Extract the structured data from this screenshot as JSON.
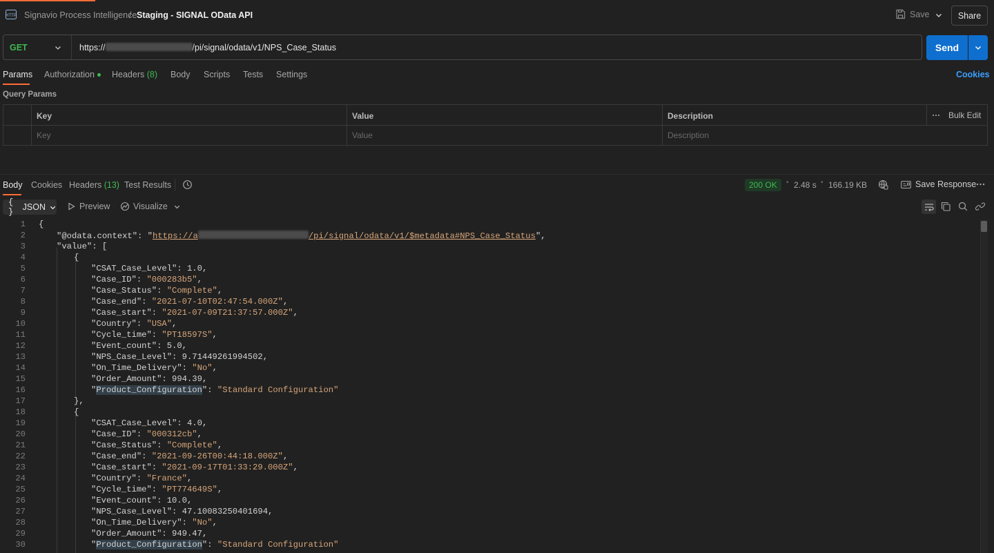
{
  "breadcrumb": {
    "workspace": "Signavio Process Intelligence",
    "separator": "/",
    "request_name": "Staging - SIGNAL OData API"
  },
  "header": {
    "save_label": "Save",
    "share_label": "Share"
  },
  "request": {
    "method": "GET",
    "url_prefix": "https://",
    "url_suffix": "/pi/signal/odata/v1/NPS_Case_Status",
    "send_label": "Send"
  },
  "request_tabs": {
    "params": "Params",
    "authorization": "Authorization",
    "headers": "Headers",
    "headers_count": "(8)",
    "body": "Body",
    "scripts": "Scripts",
    "tests": "Tests",
    "settings": "Settings",
    "cookies": "Cookies"
  },
  "query_params": {
    "title": "Query Params",
    "columns": {
      "key": "Key",
      "value": "Value",
      "description": "Description"
    },
    "bulk_edit": "Bulk Edit",
    "placeholders": {
      "key": "Key",
      "value": "Value",
      "description": "Description"
    }
  },
  "response_tabs": {
    "body": "Body",
    "cookies": "Cookies",
    "headers": "Headers",
    "headers_count": "(13)",
    "test_results": "Test Results"
  },
  "response_meta": {
    "status": "200 OK",
    "time": "2.48 s",
    "size": "166.19 KB",
    "save_response": "Save Response"
  },
  "view_options": {
    "format": "JSON",
    "preview": "Preview",
    "visualize": "Visualize"
  },
  "colors": {
    "accent": "#ff6c37",
    "send": "#0f6fcf",
    "status_ok": "#3fb950",
    "link": "#3b9eff"
  },
  "code": {
    "line_numbers": [
      "1",
      "2",
      "3",
      "4",
      "5",
      "6",
      "7",
      "8",
      "9",
      "10",
      "11",
      "12",
      "13",
      "14",
      "15",
      "16",
      "17",
      "18",
      "19",
      "20",
      "21",
      "22",
      "23",
      "24",
      "25",
      "26",
      "27",
      "28",
      "29",
      "30"
    ],
    "l1": "{",
    "l2_key": "\"@odata.context\"",
    "l2_url_a": "https://a",
    "l2_url_b": "/pi/signal/odata/v1/$metadata#NPS_Case_Status",
    "l3": "\"value\": [",
    "l4": "{",
    "records": [
      [
        [
          "\"CSAT_Case_Level\"",
          "1.0",
          "num"
        ],
        [
          "\"Case_ID\"",
          "\"000283b5\"",
          "str"
        ],
        [
          "\"Case_Status\"",
          "\"Complete\"",
          "str"
        ],
        [
          "\"Case_end\"",
          "\"2021-07-10T02:47:54.000Z\"",
          "str"
        ],
        [
          "\"Case_start\"",
          "\"2021-07-09T21:37:57.000Z\"",
          "str"
        ],
        [
          "\"Country\"",
          "\"USA\"",
          "str"
        ],
        [
          "\"Cycle_time\"",
          "\"PT18597S\"",
          "str"
        ],
        [
          "\"Event_count\"",
          "5.0",
          "num"
        ],
        [
          "\"NPS_Case_Level\"",
          "9.71449261994502",
          "num"
        ],
        [
          "\"On_Time_Delivery\"",
          "\"No\"",
          "str"
        ],
        [
          "\"Order_Amount\"",
          "994.39",
          "num"
        ],
        [
          "\"Product_Configuration\"",
          "\"Standard Configuration\"",
          "last"
        ]
      ],
      [
        [
          "\"CSAT_Case_Level\"",
          "4.0",
          "num"
        ],
        [
          "\"Case_ID\"",
          "\"000312cb\"",
          "str"
        ],
        [
          "\"Case_Status\"",
          "\"Complete\"",
          "str"
        ],
        [
          "\"Case_end\"",
          "\"2021-09-26T00:44:18.000Z\"",
          "str"
        ],
        [
          "\"Case_start\"",
          "\"2021-09-17T01:33:29.000Z\"",
          "str"
        ],
        [
          "\"Country\"",
          "\"France\"",
          "str"
        ],
        [
          "\"Cycle_time\"",
          "\"PT774649S\"",
          "str"
        ],
        [
          "\"Event_count\"",
          "10.0",
          "num"
        ],
        [
          "\"NPS_Case_Level\"",
          "47.10083250401694",
          "num"
        ],
        [
          "\"On_Time_Delivery\"",
          "\"No\"",
          "str"
        ],
        [
          "\"Order_Amount\"",
          "949.47",
          "num"
        ],
        [
          "\"Product_Configuration\"",
          "\"Standard Configuration\"",
          "last"
        ]
      ]
    ],
    "l17": "},",
    "l18": "{"
  }
}
